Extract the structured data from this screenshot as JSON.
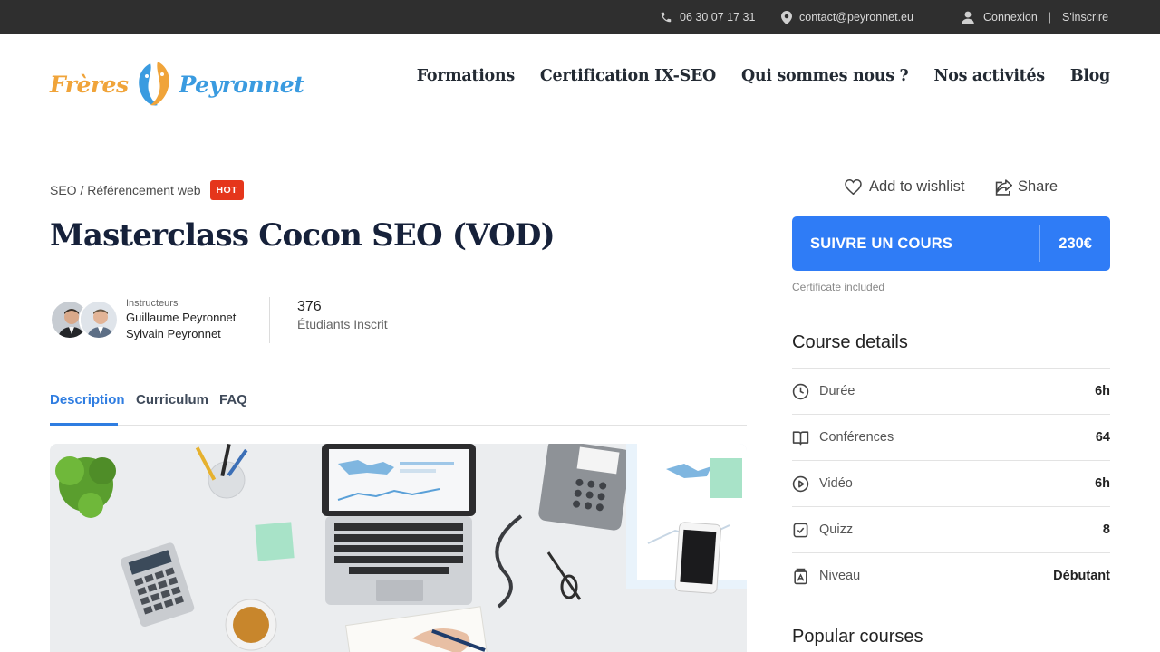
{
  "topbar": {
    "phone": "06 30 07 17 31",
    "email": "contact@peyronnet.eu",
    "login": "Connexion",
    "separator": "|",
    "register": "S'inscrire"
  },
  "header": {
    "logo_word1": "Frères",
    "logo_word2": "Peyronnet",
    "nav": [
      "Formations",
      "Certification IX-SEO",
      "Qui sommes nous ?",
      "Nos activités",
      "Blog"
    ]
  },
  "course": {
    "category": "SEO / Référencement web",
    "badge": "HOT",
    "title": "Masterclass Cocon SEO (VOD)",
    "instructors_label": "Instructeurs",
    "instructors": [
      "Guillaume Peyronnet",
      "Sylvain Peyronnet"
    ],
    "students_count": "376",
    "students_label": "Étudiants Inscrit",
    "tabs": [
      "Description",
      "Curriculum",
      "FAQ"
    ],
    "active_tab": "Description"
  },
  "sidebar": {
    "wishlist": "Add to wishlist",
    "share": "Share",
    "cta_label": "SUIVRE UN COURS",
    "cta_price": "230€",
    "certificate": "Certificate included",
    "details_title": "Course details",
    "details": [
      {
        "icon": "clock-icon",
        "label": "Durée",
        "value": "6h"
      },
      {
        "icon": "book-open-icon",
        "label": "Conférences",
        "value": "64"
      },
      {
        "icon": "play-circle-icon",
        "label": "Vidéo",
        "value": "6h"
      },
      {
        "icon": "checkbox-icon",
        "label": "Quizz",
        "value": "8"
      },
      {
        "icon": "level-icon",
        "label": "Niveau",
        "value": "Débutant"
      }
    ],
    "popular_title": "Popular courses"
  },
  "colors": {
    "accent": "#2f7cf6",
    "hot": "#e5361b",
    "topbar": "#2f2f2f",
    "logo_orange": "#f0a43a",
    "logo_blue": "#3a9be0"
  }
}
